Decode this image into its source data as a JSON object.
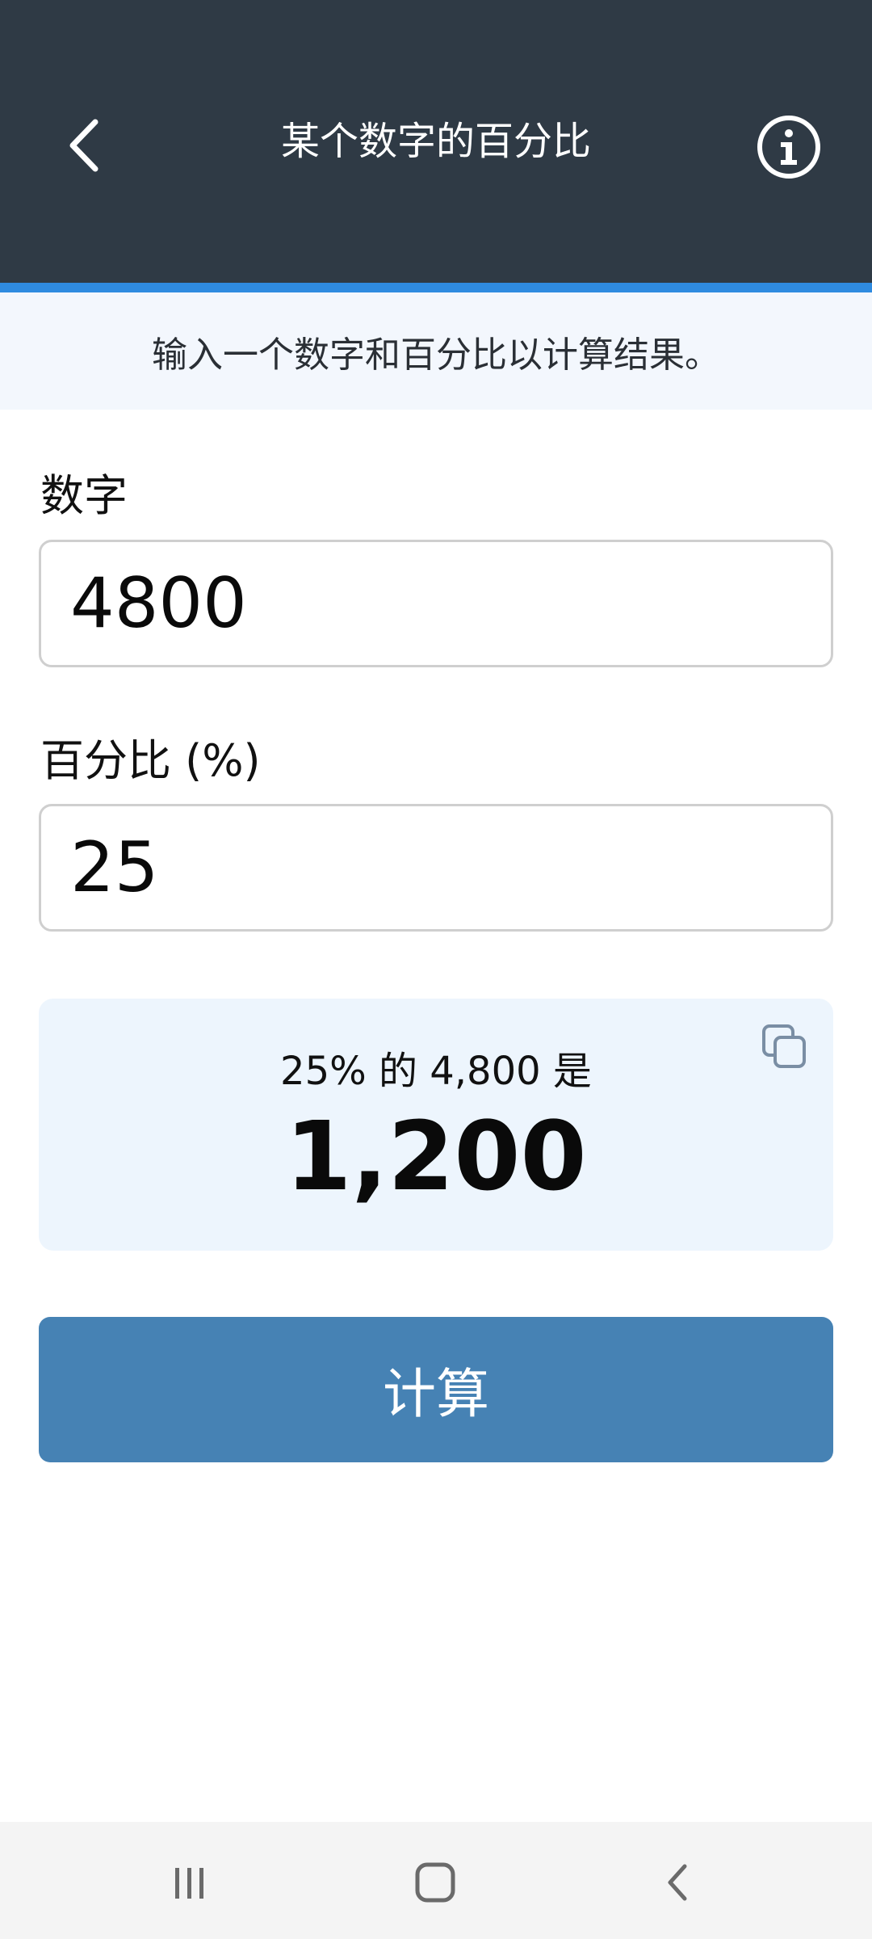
{
  "header": {
    "title": "某个数字的百分比",
    "back_icon": "chevron-left-icon",
    "info_icon": "info-circle-icon",
    "background_color": "#2f3a45",
    "accent_color": "#2f8be0"
  },
  "instruction": {
    "text": "输入一个数字和百分比以计算结果。"
  },
  "form": {
    "number": {
      "label": "数字",
      "value": "4800"
    },
    "percent": {
      "label": "百分比 (%)",
      "value": "25"
    }
  },
  "result": {
    "sentence": "25% 的 4,800 是",
    "value": "1,200",
    "copy_icon": "copy-icon"
  },
  "calculate_button": {
    "label": "计算",
    "color": "#4682b4"
  },
  "system_nav": {
    "recents_icon": "recents-icon",
    "home_icon": "home-icon",
    "back_icon": "back-icon"
  }
}
